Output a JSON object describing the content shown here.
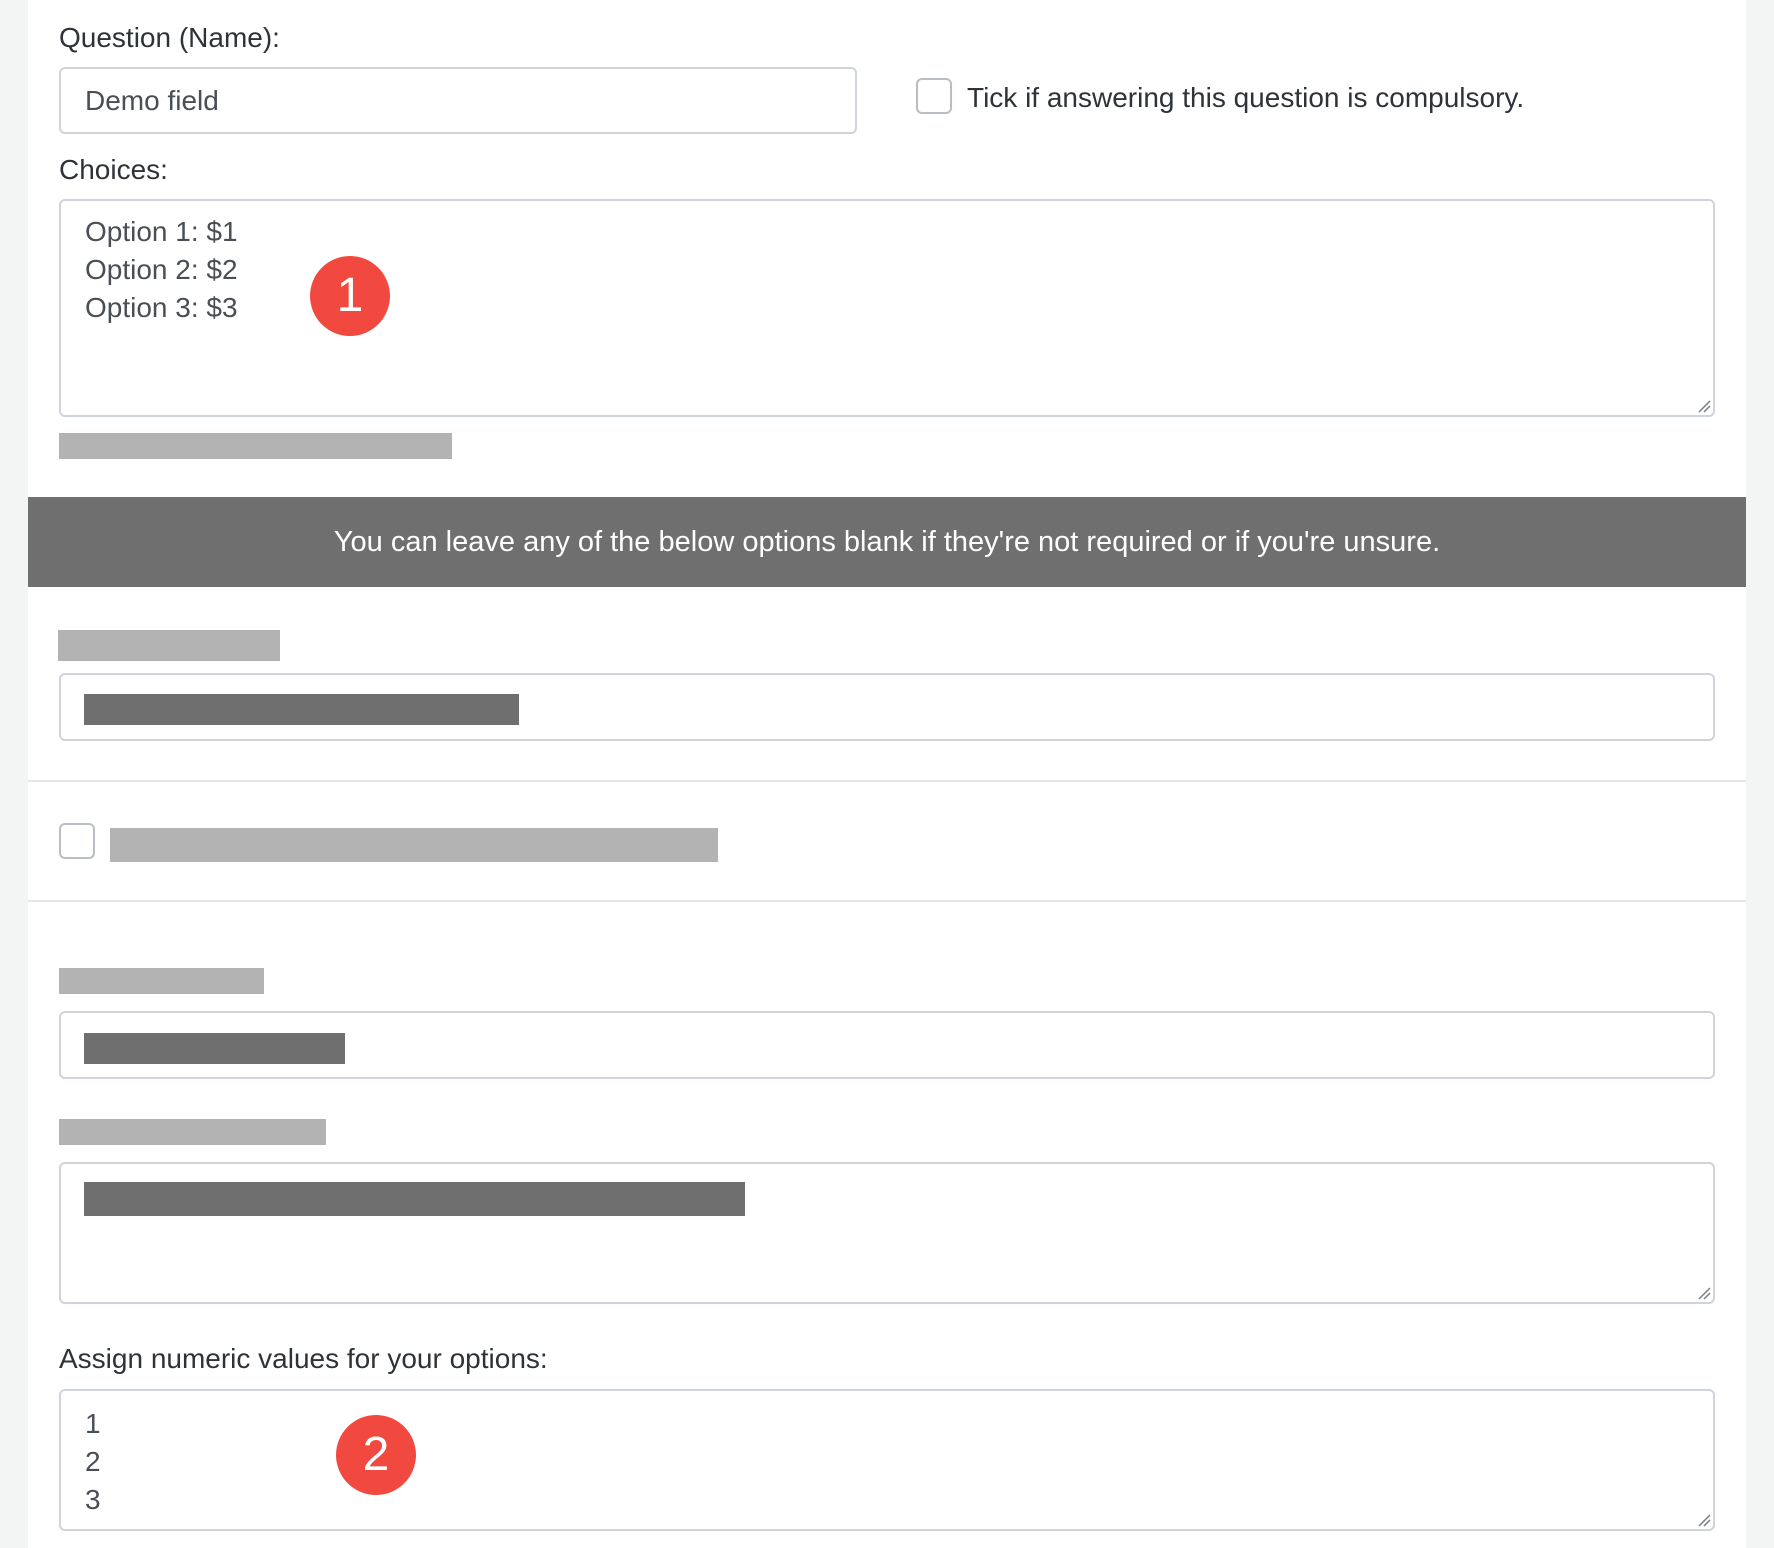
{
  "question": {
    "label": "Question (Name):",
    "value": "Demo field",
    "compulsory_label": "Tick if answering this question is compulsory.",
    "compulsory_checked": false
  },
  "choices": {
    "label": "Choices:",
    "lines": [
      "Option 1: $1",
      "Option 2: $2",
      "Option 3: $3"
    ]
  },
  "banner": {
    "text": "You can leave any of the below options blank if they're not required or if you're unsure."
  },
  "numeric": {
    "label": "Assign numeric values for your options:",
    "lines": [
      "1",
      "2",
      "3"
    ]
  },
  "annotations": {
    "badge_1": "1",
    "badge_2": "2"
  },
  "colors": {
    "badge": "#f1493f",
    "banner": "#6f6f6f",
    "redaction_light": "#b3b3b3",
    "redaction_dark": "#6f6f6f"
  }
}
